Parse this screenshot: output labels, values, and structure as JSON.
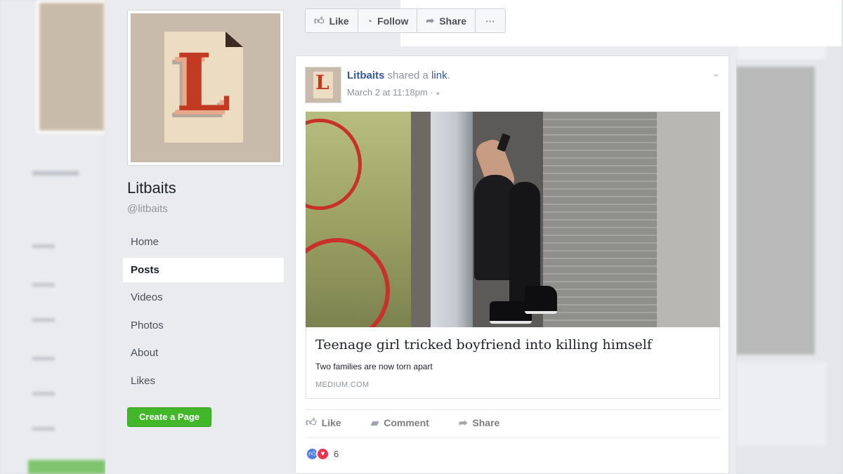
{
  "page": {
    "name": "Litbaits",
    "handle": "@litbaits",
    "logo_letter": "L"
  },
  "nav": {
    "items": [
      {
        "label": "Home",
        "active": false
      },
      {
        "label": "Posts",
        "active": true
      },
      {
        "label": "Videos",
        "active": false
      },
      {
        "label": "Photos",
        "active": false
      },
      {
        "label": "About",
        "active": false
      },
      {
        "label": "Likes",
        "active": false
      }
    ]
  },
  "create_page_label": "Create a Page",
  "action_bar": {
    "like": "Like",
    "follow": "Follow",
    "share": "Share",
    "more": "···"
  },
  "post": {
    "author": "Litbaits",
    "action_text": "shared a",
    "object_text": "link",
    "timestamp": "March 2 at 11:18pm",
    "privacy_glyph": "🌐",
    "link": {
      "title": "Teenage girl tricked boyfriend into killing himself",
      "subtitle": "Two families are now torn apart",
      "source": "MEDIUM.COM"
    },
    "actions": {
      "like": "Like",
      "comment": "Comment",
      "share": "Share"
    },
    "reaction_count": "6"
  },
  "colors": {
    "link_blue": "#365899",
    "create_green": "#42b72a",
    "like_reaction": "#4e7ee0",
    "love_reaction": "#e8344f"
  }
}
